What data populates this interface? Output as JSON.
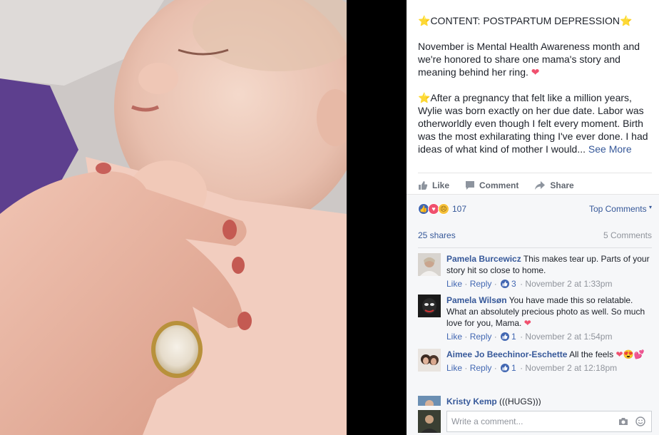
{
  "post": {
    "heading_prefix": "⭐",
    "heading": "CONTENT: POSTPARTUM DEPRESSION",
    "heading_suffix": "⭐",
    "para1": "November is Mental Health Awareness month and we're honored to share one mama's story and meaning behind her ring.",
    "para1_emoji": "❤",
    "para2_prefix": "⭐",
    "para2": "After a pregnancy that felt like a million years, Wylie was born exactly on her due date. Labor was otherworldly even though I felt every moment. Birth was the most exhilarating thing I've ever done. I had ideas of what kind of mother I would...",
    "see_more": "See More"
  },
  "actions": {
    "like": "Like",
    "comment": "Comment",
    "share": "Share"
  },
  "feedback": {
    "reaction_count": "107",
    "top_comments": "Top Comments",
    "shares": "25 shares",
    "comments_count": "5 Comments"
  },
  "comments": [
    {
      "name": "Pamela Burcewicz",
      "text": "This makes tear up. Parts of your story hit so close to home.",
      "emoji": "",
      "like": "Like",
      "reply": "Reply",
      "likes": "3",
      "time": "November 2 at 1:33pm"
    },
    {
      "name": "Pamela Wilsøn",
      "text": "You have made this so relatable. What an absolutely precious photo as well. So much love for you, Mama.",
      "emoji": "❤",
      "like": "Like",
      "reply": "Reply",
      "likes": "1",
      "time": "November 2 at 1:54pm"
    },
    {
      "name": "Aimee Jo Beechinor-Eschette",
      "text": "All the feels",
      "emoji": "❤😍💕",
      "like": "Like",
      "reply": "Reply",
      "likes": "1",
      "time": "November 2 at 12:18pm"
    },
    {
      "name": "Kristy Kemp",
      "text": "(((HUGS)))",
      "emoji": "",
      "like": "",
      "reply": "",
      "likes": "",
      "time": ""
    }
  ],
  "write": {
    "placeholder": "Write a comment..."
  },
  "separators": {
    "dot": " · "
  },
  "colors": {
    "link": "#365899",
    "accent": "#4267b2",
    "love": "#f0506e"
  }
}
